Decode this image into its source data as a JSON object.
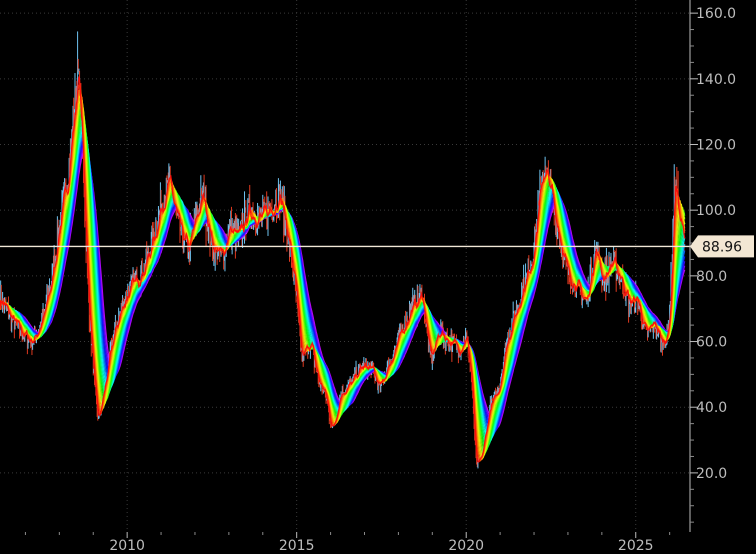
{
  "chart_data": {
    "type": "candlestick",
    "grid": true,
    "x_axis": {
      "ticks": [
        2010,
        2015,
        2020,
        2025
      ],
      "tick_labels": [
        "2010",
        "2015",
        "2020",
        "2025"
      ],
      "range": [
        2006.25,
        2026.6
      ]
    },
    "y_axis": {
      "position": "right",
      "ticks": [
        20,
        40,
        60,
        80,
        100,
        120,
        140,
        160
      ],
      "tick_labels": [
        "20.0",
        "40.0",
        "60.0",
        "80.0",
        "100.0",
        "120.0",
        "140.0",
        "160.0"
      ],
      "range": [
        2,
        164
      ]
    },
    "last_price": {
      "value": 88.96,
      "label": "88.96"
    },
    "colors": {
      "background": "#000000",
      "up": "#6fc3f0",
      "down": "#e0391f",
      "last_line": "#f2e8d8",
      "label_bg": "#f3e7d3",
      "grid": "#3a3a3a"
    },
    "price_path": [
      [
        2006.25,
        73
      ],
      [
        2006.6,
        67
      ],
      [
        2006.9,
        63
      ],
      [
        2007.2,
        60
      ],
      [
        2007.5,
        66
      ],
      [
        2007.8,
        80
      ],
      [
        2008.0,
        95
      ],
      [
        2008.25,
        110
      ],
      [
        2008.45,
        130
      ],
      [
        2008.55,
        142
      ],
      [
        2008.7,
        115
      ],
      [
        2008.85,
        75
      ],
      [
        2009.05,
        45
      ],
      [
        2009.15,
        36
      ],
      [
        2009.35,
        47
      ],
      [
        2009.6,
        62
      ],
      [
        2009.9,
        72
      ],
      [
        2010.2,
        78
      ],
      [
        2010.5,
        82
      ],
      [
        2010.8,
        92
      ],
      [
        2011.05,
        103
      ],
      [
        2011.25,
        108
      ],
      [
        2011.5,
        96
      ],
      [
        2011.8,
        88
      ],
      [
        2012.1,
        100
      ],
      [
        2012.25,
        104
      ],
      [
        2012.5,
        90
      ],
      [
        2012.8,
        86
      ],
      [
        2013.0,
        94
      ],
      [
        2013.3,
        92
      ],
      [
        2013.6,
        100
      ],
      [
        2013.9,
        97
      ],
      [
        2014.2,
        100
      ],
      [
        2014.5,
        104
      ],
      [
        2014.7,
        95
      ],
      [
        2014.95,
        78
      ],
      [
        2015.15,
        55
      ],
      [
        2015.4,
        60
      ],
      [
        2015.65,
        48
      ],
      [
        2015.85,
        44
      ],
      [
        2016.05,
        33
      ],
      [
        2016.3,
        44
      ],
      [
        2016.6,
        47
      ],
      [
        2016.9,
        52
      ],
      [
        2017.2,
        52
      ],
      [
        2017.45,
        46
      ],
      [
        2017.8,
        55
      ],
      [
        2018.1,
        63
      ],
      [
        2018.4,
        70
      ],
      [
        2018.7,
        74
      ],
      [
        2018.95,
        55
      ],
      [
        2019.2,
        63
      ],
      [
        2019.5,
        60
      ],
      [
        2019.8,
        58
      ],
      [
        2020.0,
        61
      ],
      [
        2020.15,
        50
      ],
      [
        2020.3,
        22
      ],
      [
        2020.45,
        25
      ],
      [
        2020.7,
        40
      ],
      [
        2020.95,
        45
      ],
      [
        2021.2,
        60
      ],
      [
        2021.5,
        70
      ],
      [
        2021.8,
        80
      ],
      [
        2022.0,
        88
      ],
      [
        2022.25,
        112
      ],
      [
        2022.45,
        108
      ],
      [
        2022.7,
        95
      ],
      [
        2022.95,
        82
      ],
      [
        2023.3,
        76
      ],
      [
        2023.55,
        72
      ],
      [
        2023.8,
        88
      ],
      [
        2024.05,
        79
      ],
      [
        2024.3,
        84
      ],
      [
        2024.55,
        80
      ],
      [
        2024.8,
        72
      ],
      [
        2025.05,
        73
      ],
      [
        2025.3,
        62
      ],
      [
        2025.55,
        66
      ],
      [
        2025.75,
        60
      ],
      [
        2025.95,
        62
      ],
      [
        2026.05,
        78
      ],
      [
        2026.15,
        110
      ],
      [
        2026.25,
        100
      ],
      [
        2026.45,
        89
      ]
    ],
    "moving_averages": {
      "count": 18,
      "min_period": 4,
      "step": 2,
      "color_order": "short red to long violet"
    }
  }
}
